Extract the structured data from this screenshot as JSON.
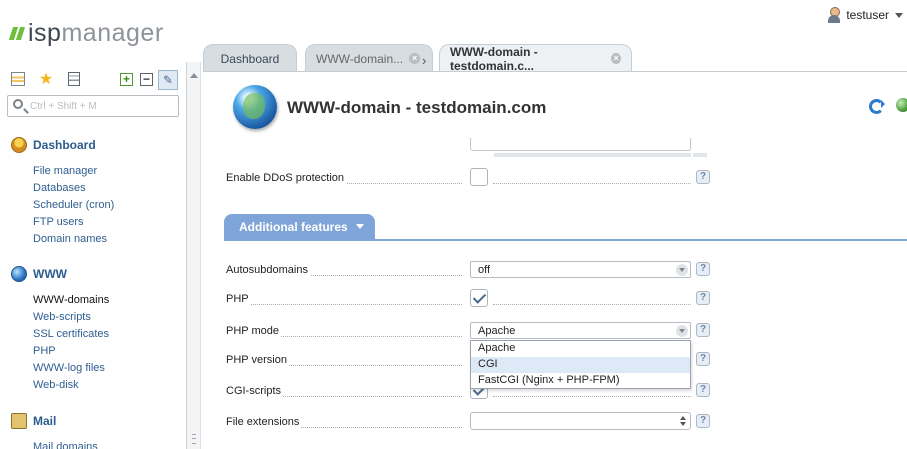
{
  "logo": {
    "part1": "isp",
    "part2": "manager"
  },
  "user": {
    "name": "testuser"
  },
  "sidebar": {
    "search_placeholder": "Ctrl + Shift + M",
    "sections": [
      {
        "title": "Dashboard",
        "items": [
          "File manager",
          "Databases",
          "Scheduler (cron)",
          "FTP users",
          "Domain names"
        ]
      },
      {
        "title": "WWW",
        "items": [
          "WWW-domains",
          "Web-scripts",
          "SSL certificates",
          "PHP",
          "WWW-log files",
          "Web-disk"
        ]
      },
      {
        "title": "Mail",
        "items": [
          "Mail domains"
        ]
      }
    ]
  },
  "tabs": [
    {
      "label": "Dashboard"
    },
    {
      "label": "WWW-domain..."
    },
    {
      "label": "WWW-domain - testdomain.c..."
    }
  ],
  "page": {
    "title": "WWW-domain - testdomain.com"
  },
  "form": {
    "ddos_label": "Enable DDoS protection",
    "section_title": "Additional features",
    "autosubdomains_label": "Autosubdomains",
    "autosubdomains_value": "off",
    "php_label": "PHP",
    "php_mode_label": "PHP mode",
    "php_mode_value": "Apache",
    "php_version_label": "PHP version",
    "cgi_label": "CGI-scripts",
    "file_ext_label": "File extensions",
    "help": "?"
  },
  "php_mode_options": [
    "Apache",
    "CGI",
    "FastCGI (Nginx + PHP-FPM)"
  ]
}
